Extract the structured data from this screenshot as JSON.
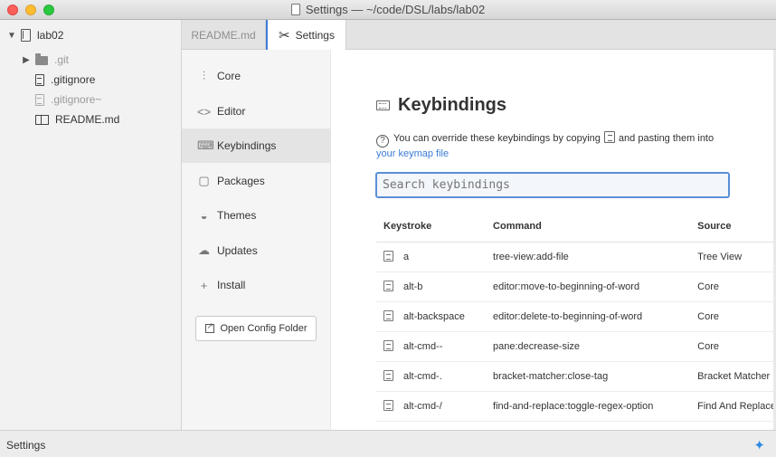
{
  "window": {
    "title": "Settings — ~/code/DSL/labs/lab02"
  },
  "tree": {
    "root": "lab02",
    "items": [
      {
        "label": ".git",
        "type": "folder",
        "dim": true
      },
      {
        "label": ".gitignore",
        "type": "file",
        "dim": false
      },
      {
        "label": ".gitignore~",
        "type": "file",
        "dim": true
      },
      {
        "label": "README.md",
        "type": "book",
        "dim": false
      }
    ]
  },
  "tabs": [
    {
      "label": "README.md",
      "active": false
    },
    {
      "label": "Settings",
      "active": true
    }
  ],
  "menu": {
    "items": [
      {
        "label": "Core",
        "icon": "sliders-icon"
      },
      {
        "label": "Editor",
        "icon": "code-icon"
      },
      {
        "label": "Keybindings",
        "icon": "keyboard-icon"
      },
      {
        "label": "Packages",
        "icon": "package-icon"
      },
      {
        "label": "Themes",
        "icon": "paintcan-icon"
      },
      {
        "label": "Updates",
        "icon": "cloud-download-icon"
      },
      {
        "label": "Install",
        "icon": "plus-icon"
      }
    ],
    "active": "Keybindings",
    "open_config_label": "Open Config Folder"
  },
  "keybindings": {
    "heading": "Keybindings",
    "hint_before": "You can override these keybindings by copying",
    "hint_after": "and pasting them into",
    "hint_link": "your keymap file",
    "search_placeholder": "Search keybindings",
    "columns": [
      "Keystroke",
      "Command",
      "Source"
    ],
    "rows": [
      {
        "keystroke": "a",
        "command": "tree-view:add-file",
        "source": "Tree View"
      },
      {
        "keystroke": "alt-b",
        "command": "editor:move-to-beginning-of-word",
        "source": "Core"
      },
      {
        "keystroke": "alt-backspace",
        "command": "editor:delete-to-beginning-of-word",
        "source": "Core"
      },
      {
        "keystroke": "alt-cmd--",
        "command": "pane:decrease-size",
        "source": "Core"
      },
      {
        "keystroke": "alt-cmd-.",
        "command": "bracket-matcher:close-tag",
        "source": "Bracket Matcher"
      },
      {
        "keystroke": "alt-cmd-/",
        "command": "find-and-replace:toggle-regex-option",
        "source": "Find And Replace"
      }
    ]
  },
  "status": {
    "text": "Settings"
  }
}
